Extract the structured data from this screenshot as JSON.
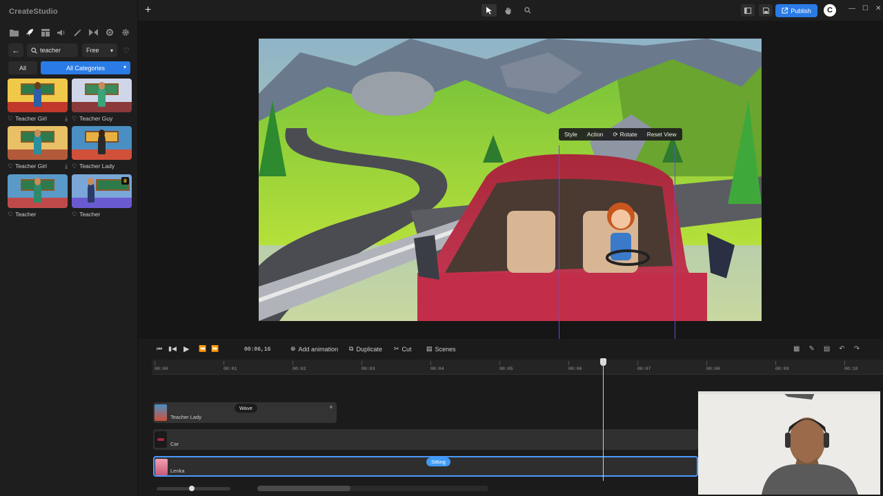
{
  "app": {
    "title": "CreateStudio"
  },
  "sidebar": {
    "tools": [
      "folder-icon",
      "rocket-icon",
      "layout-icon",
      "audio-icon",
      "magic-wand-icon",
      "transition-icon",
      "effects-icon",
      "gear-icon"
    ],
    "search": {
      "value": "teacher",
      "placeholder": "Search"
    },
    "filter": {
      "selected": "Free"
    },
    "all_label": "All",
    "category_label": "All Categories",
    "cards": [
      {
        "name": "Teacher Girl",
        "downloadable": true,
        "premium": false
      },
      {
        "name": "Teacher Guy",
        "downloadable": false,
        "premium": false
      },
      {
        "name": "Teacher Girl",
        "downloadable": true,
        "premium": false
      },
      {
        "name": "Teacher Lady",
        "downloadable": false,
        "premium": false
      },
      {
        "name": "Teacher",
        "downloadable": false,
        "premium": false
      },
      {
        "name": "Teacher",
        "downloadable": false,
        "premium": true
      }
    ]
  },
  "topbar": {
    "publish_label": "Publish",
    "tools": [
      "select-arrow-icon",
      "hand-icon",
      "zoom-icon"
    ]
  },
  "canvas": {
    "context_menu": {
      "style": "Style",
      "action": "Action",
      "rotate": "Rotate",
      "reset": "Reset View"
    }
  },
  "timeline": {
    "time": "00:06,16",
    "add_animation": "Add animation",
    "duplicate": "Duplicate",
    "cut": "Cut",
    "scenes": "Scenes",
    "ticks": [
      "00:00",
      "00:01",
      "00:02",
      "00:03",
      "00:04",
      "00:05",
      "00:06",
      "00:07",
      "00:08",
      "00:09",
      "00:10"
    ],
    "tracks": [
      {
        "label": "Teacher Lady",
        "pill": "Wave"
      },
      {
        "label": "Car",
        "pill": ""
      },
      {
        "label": "Lenka",
        "pill": "Sitting"
      }
    ],
    "zoom_level": 0.48,
    "scroll_position": 0.0
  },
  "colors": {
    "accent": "#2a7be6",
    "selection": "#4a9bff",
    "premium": "#f5c518"
  }
}
